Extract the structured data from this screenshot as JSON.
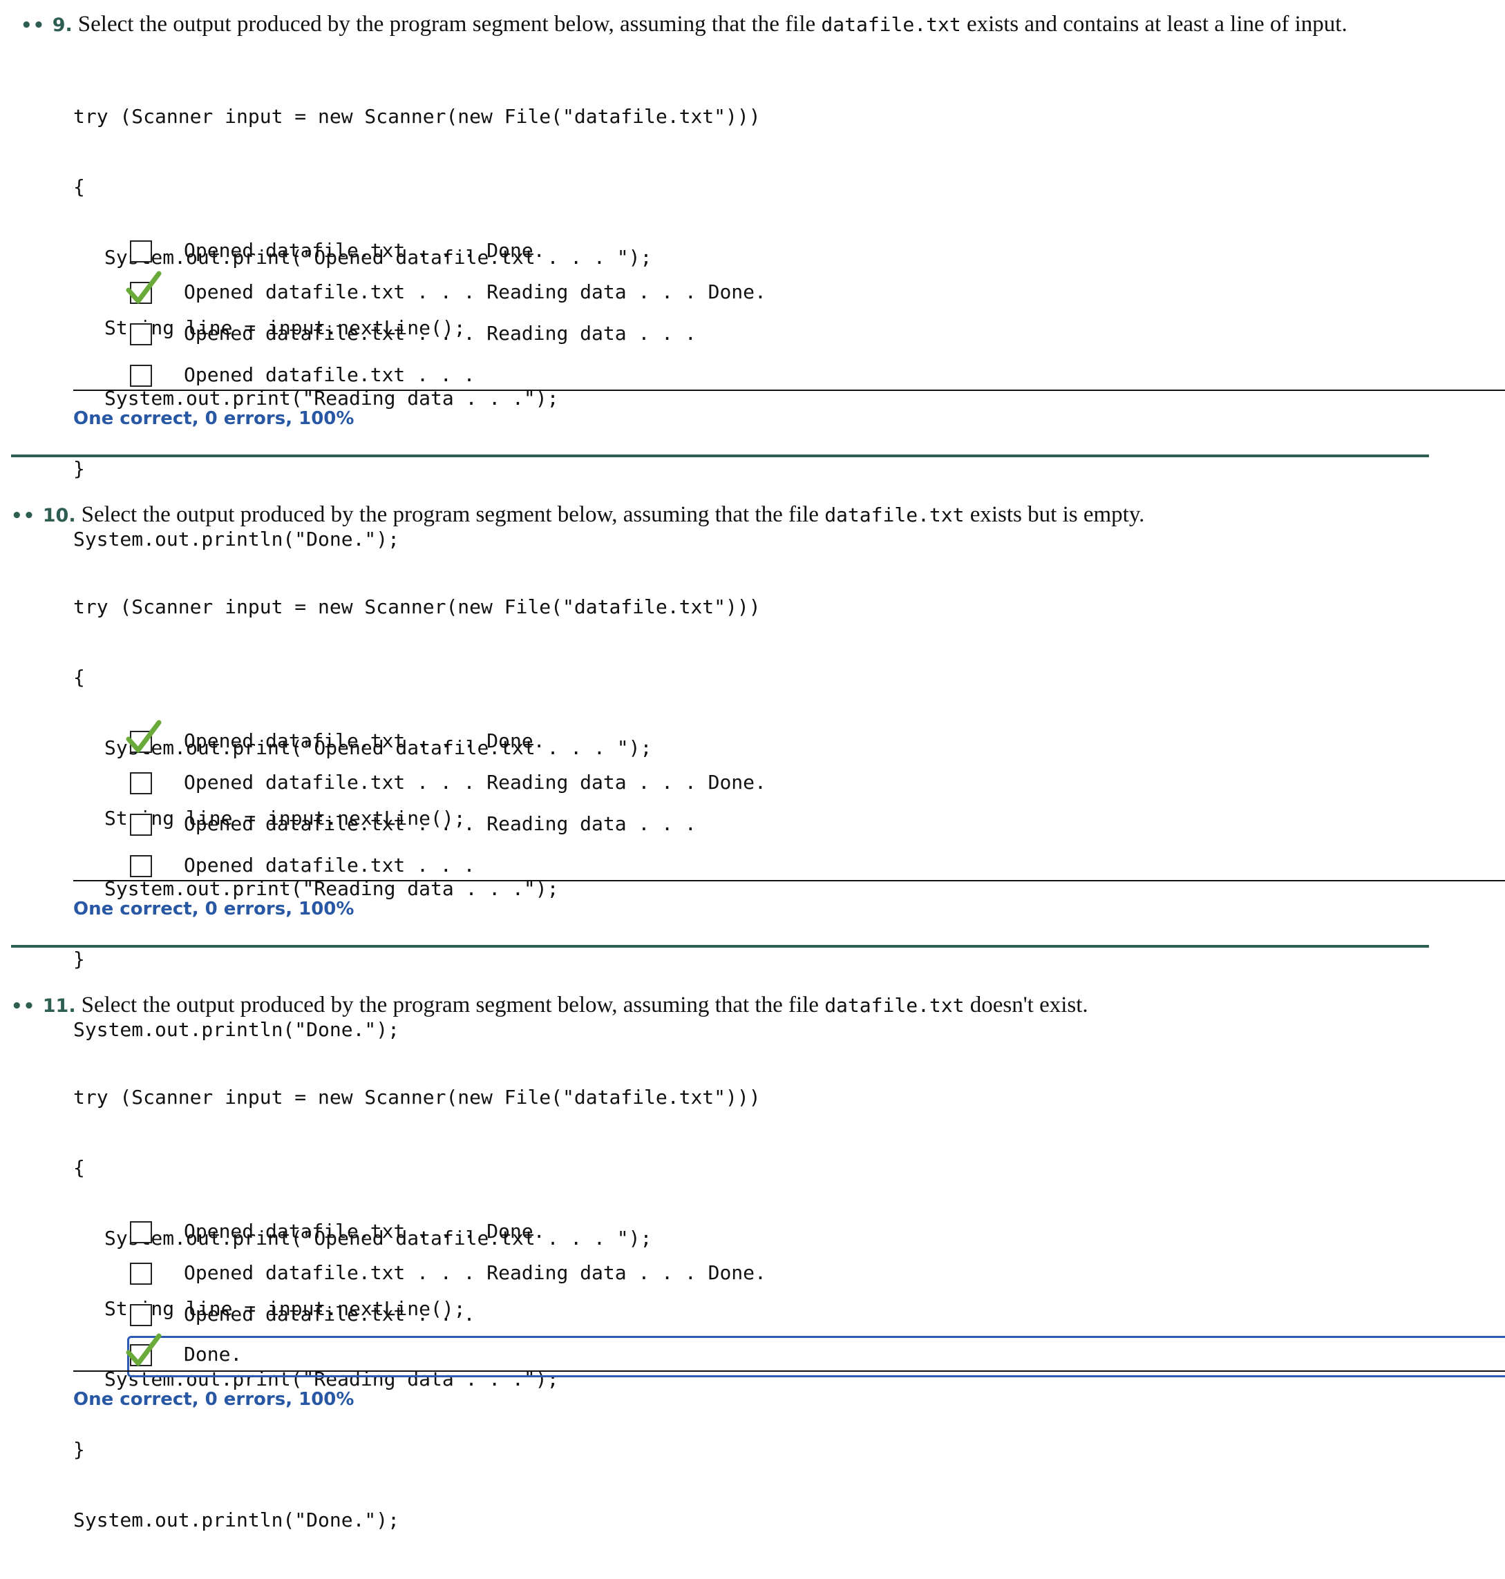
{
  "colors": {
    "accent_green": "#2e5e52",
    "score_blue": "#2857a4",
    "check_green": "#6aaa3a",
    "focus_outline": "#2b5bb3"
  },
  "questions": [
    {
      "dots": "••",
      "number": "9.",
      "text_before": "Select the output produced by the program segment below, assuming that the file ",
      "filename": "datafile.txt",
      "text_after": " exists and contains at least a line of input.",
      "code": [
        "try (Scanner input = new Scanner(new File(\"datafile.txt\")))",
        "{",
        "System.out.print(\"Opened datafile.txt . . . \");",
        "String line = input.nextLine();",
        "System.out.print(\"Reading data . . .\");",
        "}",
        "System.out.println(\"Done.\");"
      ],
      "options": [
        {
          "label": "Opened datafile.txt . . . Done.",
          "checked": false
        },
        {
          "label": "Opened datafile.txt . . . Reading data . . . Done.",
          "checked": true
        },
        {
          "label": "Opened datafile.txt . . . Reading data . . .",
          "checked": false
        },
        {
          "label": "Opened datafile.txt . . .",
          "checked": false
        }
      ],
      "score": "One correct, 0 errors, 100%"
    },
    {
      "dots": "••",
      "number": "10.",
      "text_before": "Select the output produced by the program segment below, assuming that the file ",
      "filename": "datafile.txt",
      "text_after": " exists but is empty.",
      "code": [
        "try (Scanner input = new Scanner(new File(\"datafile.txt\")))",
        "{",
        "System.out.print(\"Opened datafile.txt . . . \");",
        "String line = input.nextLine();",
        "System.out.print(\"Reading data . . .\");",
        "}",
        "System.out.println(\"Done.\");"
      ],
      "options": [
        {
          "label": "Opened datafile.txt . . . Done.",
          "checked": true
        },
        {
          "label": "Opened datafile.txt . . . Reading data . . . Done.",
          "checked": false
        },
        {
          "label": "Opened datafile.txt . . . Reading data . . .",
          "checked": false
        },
        {
          "label": "Opened datafile.txt . . .",
          "checked": false
        }
      ],
      "score": "One correct, 0 errors, 100%"
    },
    {
      "dots": "••",
      "number": "11.",
      "text_before": "Select the output produced by the program segment below, assuming that the file ",
      "filename": "datafile.txt",
      "text_after": " doesn't exist.",
      "code": [
        "try (Scanner input = new Scanner(new File(\"datafile.txt\")))",
        "{",
        "System.out.print(\"Opened datafile.txt . . . \");",
        "String line = input.nextLine();",
        "System.out.print(\"Reading data . . .\");",
        "}",
        "System.out.println(\"Done.\");"
      ],
      "options": [
        {
          "label": "Opened datafile.txt . . . Done.",
          "checked": false
        },
        {
          "label": "Opened datafile.txt . . . Reading data . . . Done.",
          "checked": false
        },
        {
          "label": "Opened datafile.txt . . .",
          "checked": false
        },
        {
          "label": "Done.",
          "checked": true
        }
      ],
      "score": "One correct, 0 errors, 100%"
    }
  ]
}
